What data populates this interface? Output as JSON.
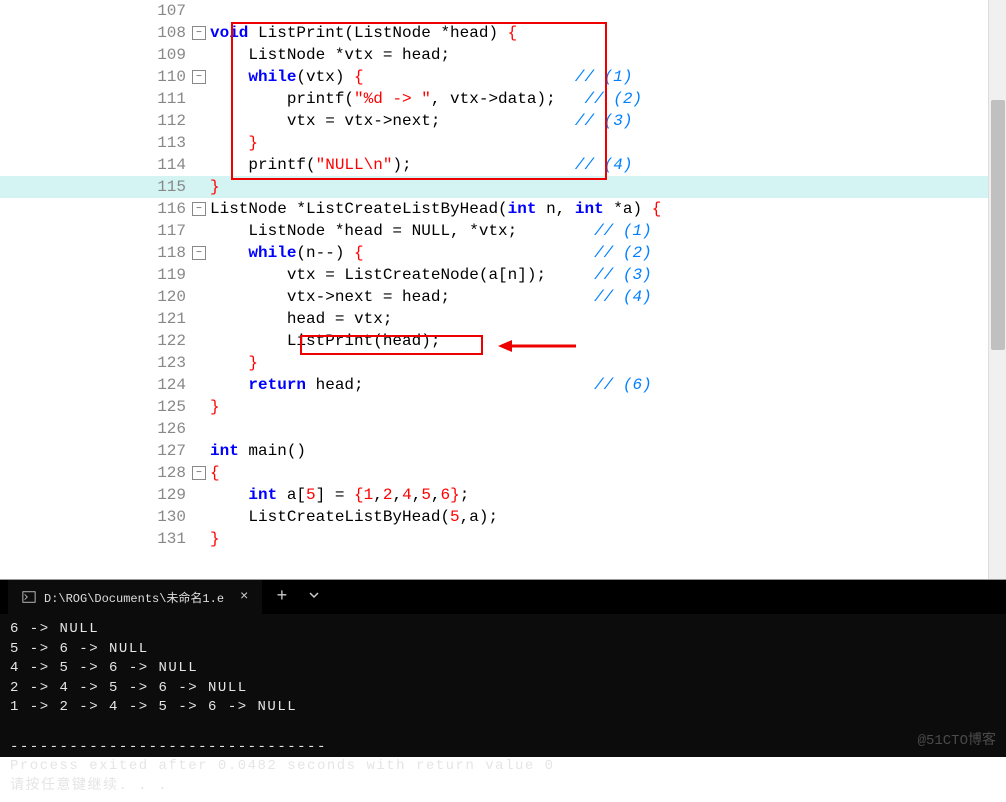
{
  "editor": {
    "lines": [
      {
        "n": 107,
        "fold": null,
        "seg": []
      },
      {
        "n": 108,
        "fold": "-",
        "seg": [
          {
            "t": "kw",
            "v": "void"
          },
          {
            "t": "p",
            "v": " ListPrint(ListNode *head) "
          },
          {
            "t": "punct",
            "v": "{"
          }
        ]
      },
      {
        "n": 109,
        "fold": null,
        "seg": [
          {
            "t": "p",
            "v": "    ListNode *vtx = head;"
          }
        ]
      },
      {
        "n": 110,
        "fold": "-",
        "seg": [
          {
            "t": "p",
            "v": "    "
          },
          {
            "t": "kw",
            "v": "while"
          },
          {
            "t": "p",
            "v": "(vtx) "
          },
          {
            "t": "punct",
            "v": "{"
          },
          {
            "t": "p",
            "v": "                      "
          },
          {
            "t": "cmt",
            "v": "// (1)"
          }
        ]
      },
      {
        "n": 111,
        "fold": null,
        "seg": [
          {
            "t": "p",
            "v": "        printf("
          },
          {
            "t": "str",
            "v": "\"%d -> \""
          },
          {
            "t": "p",
            "v": ", vtx->data);   "
          },
          {
            "t": "cmt",
            "v": "// (2)"
          }
        ]
      },
      {
        "n": 112,
        "fold": null,
        "seg": [
          {
            "t": "p",
            "v": "        vtx = vtx->next;              "
          },
          {
            "t": "cmt",
            "v": "// (3)"
          }
        ]
      },
      {
        "n": 113,
        "fold": null,
        "seg": [
          {
            "t": "p",
            "v": "    "
          },
          {
            "t": "punct",
            "v": "}"
          }
        ]
      },
      {
        "n": 114,
        "fold": null,
        "seg": [
          {
            "t": "p",
            "v": "    printf("
          },
          {
            "t": "str",
            "v": "\"NULL\\n\""
          },
          {
            "t": "p",
            "v": ");                 "
          },
          {
            "t": "cmt",
            "v": "// (4)"
          }
        ]
      },
      {
        "n": 115,
        "fold": null,
        "hl": true,
        "seg": [
          {
            "t": "punct",
            "v": "}"
          }
        ]
      },
      {
        "n": 116,
        "fold": "-",
        "seg": [
          {
            "t": "p",
            "v": "ListNode *ListCreateListByHead("
          },
          {
            "t": "kw",
            "v": "int"
          },
          {
            "t": "p",
            "v": " n, "
          },
          {
            "t": "kw",
            "v": "int"
          },
          {
            "t": "p",
            "v": " *a) "
          },
          {
            "t": "punct",
            "v": "{"
          }
        ]
      },
      {
        "n": 117,
        "fold": null,
        "seg": [
          {
            "t": "p",
            "v": "    ListNode *head = NULL, *vtx;        "
          },
          {
            "t": "cmt",
            "v": "// (1)"
          }
        ]
      },
      {
        "n": 118,
        "fold": "-",
        "seg": [
          {
            "t": "p",
            "v": "    "
          },
          {
            "t": "kw",
            "v": "while"
          },
          {
            "t": "p",
            "v": "(n--) "
          },
          {
            "t": "punct",
            "v": "{"
          },
          {
            "t": "p",
            "v": "                        "
          },
          {
            "t": "cmt",
            "v": "// (2)"
          }
        ]
      },
      {
        "n": 119,
        "fold": null,
        "seg": [
          {
            "t": "p",
            "v": "        vtx = ListCreateNode(a[n]);     "
          },
          {
            "t": "cmt",
            "v": "// (3)"
          }
        ]
      },
      {
        "n": 120,
        "fold": null,
        "seg": [
          {
            "t": "p",
            "v": "        vtx->next = head;               "
          },
          {
            "t": "cmt",
            "v": "// (4)"
          }
        ]
      },
      {
        "n": 121,
        "fold": null,
        "seg": [
          {
            "t": "p",
            "v": "        head = vtx;"
          }
        ]
      },
      {
        "n": 122,
        "fold": null,
        "seg": [
          {
            "t": "p",
            "v": "        ListPrint(head);"
          }
        ]
      },
      {
        "n": 123,
        "fold": null,
        "seg": [
          {
            "t": "p",
            "v": "    "
          },
          {
            "t": "punct",
            "v": "}"
          }
        ]
      },
      {
        "n": 124,
        "fold": null,
        "seg": [
          {
            "t": "p",
            "v": "    "
          },
          {
            "t": "kw",
            "v": "return"
          },
          {
            "t": "p",
            "v": " head;                        "
          },
          {
            "t": "cmt",
            "v": "// (6)"
          }
        ]
      },
      {
        "n": 125,
        "fold": null,
        "seg": [
          {
            "t": "punct",
            "v": "}"
          }
        ]
      },
      {
        "n": 126,
        "fold": null,
        "seg": []
      },
      {
        "n": 127,
        "fold": null,
        "seg": [
          {
            "t": "kw",
            "v": "int"
          },
          {
            "t": "p",
            "v": " main()"
          }
        ]
      },
      {
        "n": 128,
        "fold": "-",
        "seg": [
          {
            "t": "punct",
            "v": "{"
          }
        ]
      },
      {
        "n": 129,
        "fold": null,
        "seg": [
          {
            "t": "p",
            "v": "    "
          },
          {
            "t": "kw",
            "v": "int"
          },
          {
            "t": "p",
            "v": " a["
          },
          {
            "t": "num",
            "v": "5"
          },
          {
            "t": "p",
            "v": "] = "
          },
          {
            "t": "punct",
            "v": "{"
          },
          {
            "t": "num",
            "v": "1"
          },
          {
            "t": "p",
            "v": ","
          },
          {
            "t": "num",
            "v": "2"
          },
          {
            "t": "p",
            "v": ","
          },
          {
            "t": "num",
            "v": "4"
          },
          {
            "t": "p",
            "v": ","
          },
          {
            "t": "num",
            "v": "5"
          },
          {
            "t": "p",
            "v": ","
          },
          {
            "t": "num",
            "v": "6"
          },
          {
            "t": "punct",
            "v": "}"
          },
          {
            "t": "p",
            "v": ";"
          }
        ]
      },
      {
        "n": 130,
        "fold": null,
        "seg": [
          {
            "t": "p",
            "v": "    ListCreateListByHead("
          },
          {
            "t": "num",
            "v": "5"
          },
          {
            "t": "p",
            "v": ",a);"
          }
        ]
      },
      {
        "n": 131,
        "fold": null,
        "seg": [
          {
            "t": "punct",
            "v": "}"
          }
        ]
      }
    ]
  },
  "terminal": {
    "tab_title": "D:\\ROG\\Documents\\未命名1.e",
    "output": [
      "6 -> NULL",
      "5 -> 6 -> NULL",
      "4 -> 5 -> 6 -> NULL",
      "2 -> 4 -> 5 -> 6 -> NULL",
      "1 -> 2 -> 4 -> 5 -> 6 -> NULL",
      "",
      "--------------------------------",
      "Process exited after 0.0482 seconds with return value 0",
      "请按任意键继续. . ."
    ],
    "watermark": "@51CTO博客"
  }
}
